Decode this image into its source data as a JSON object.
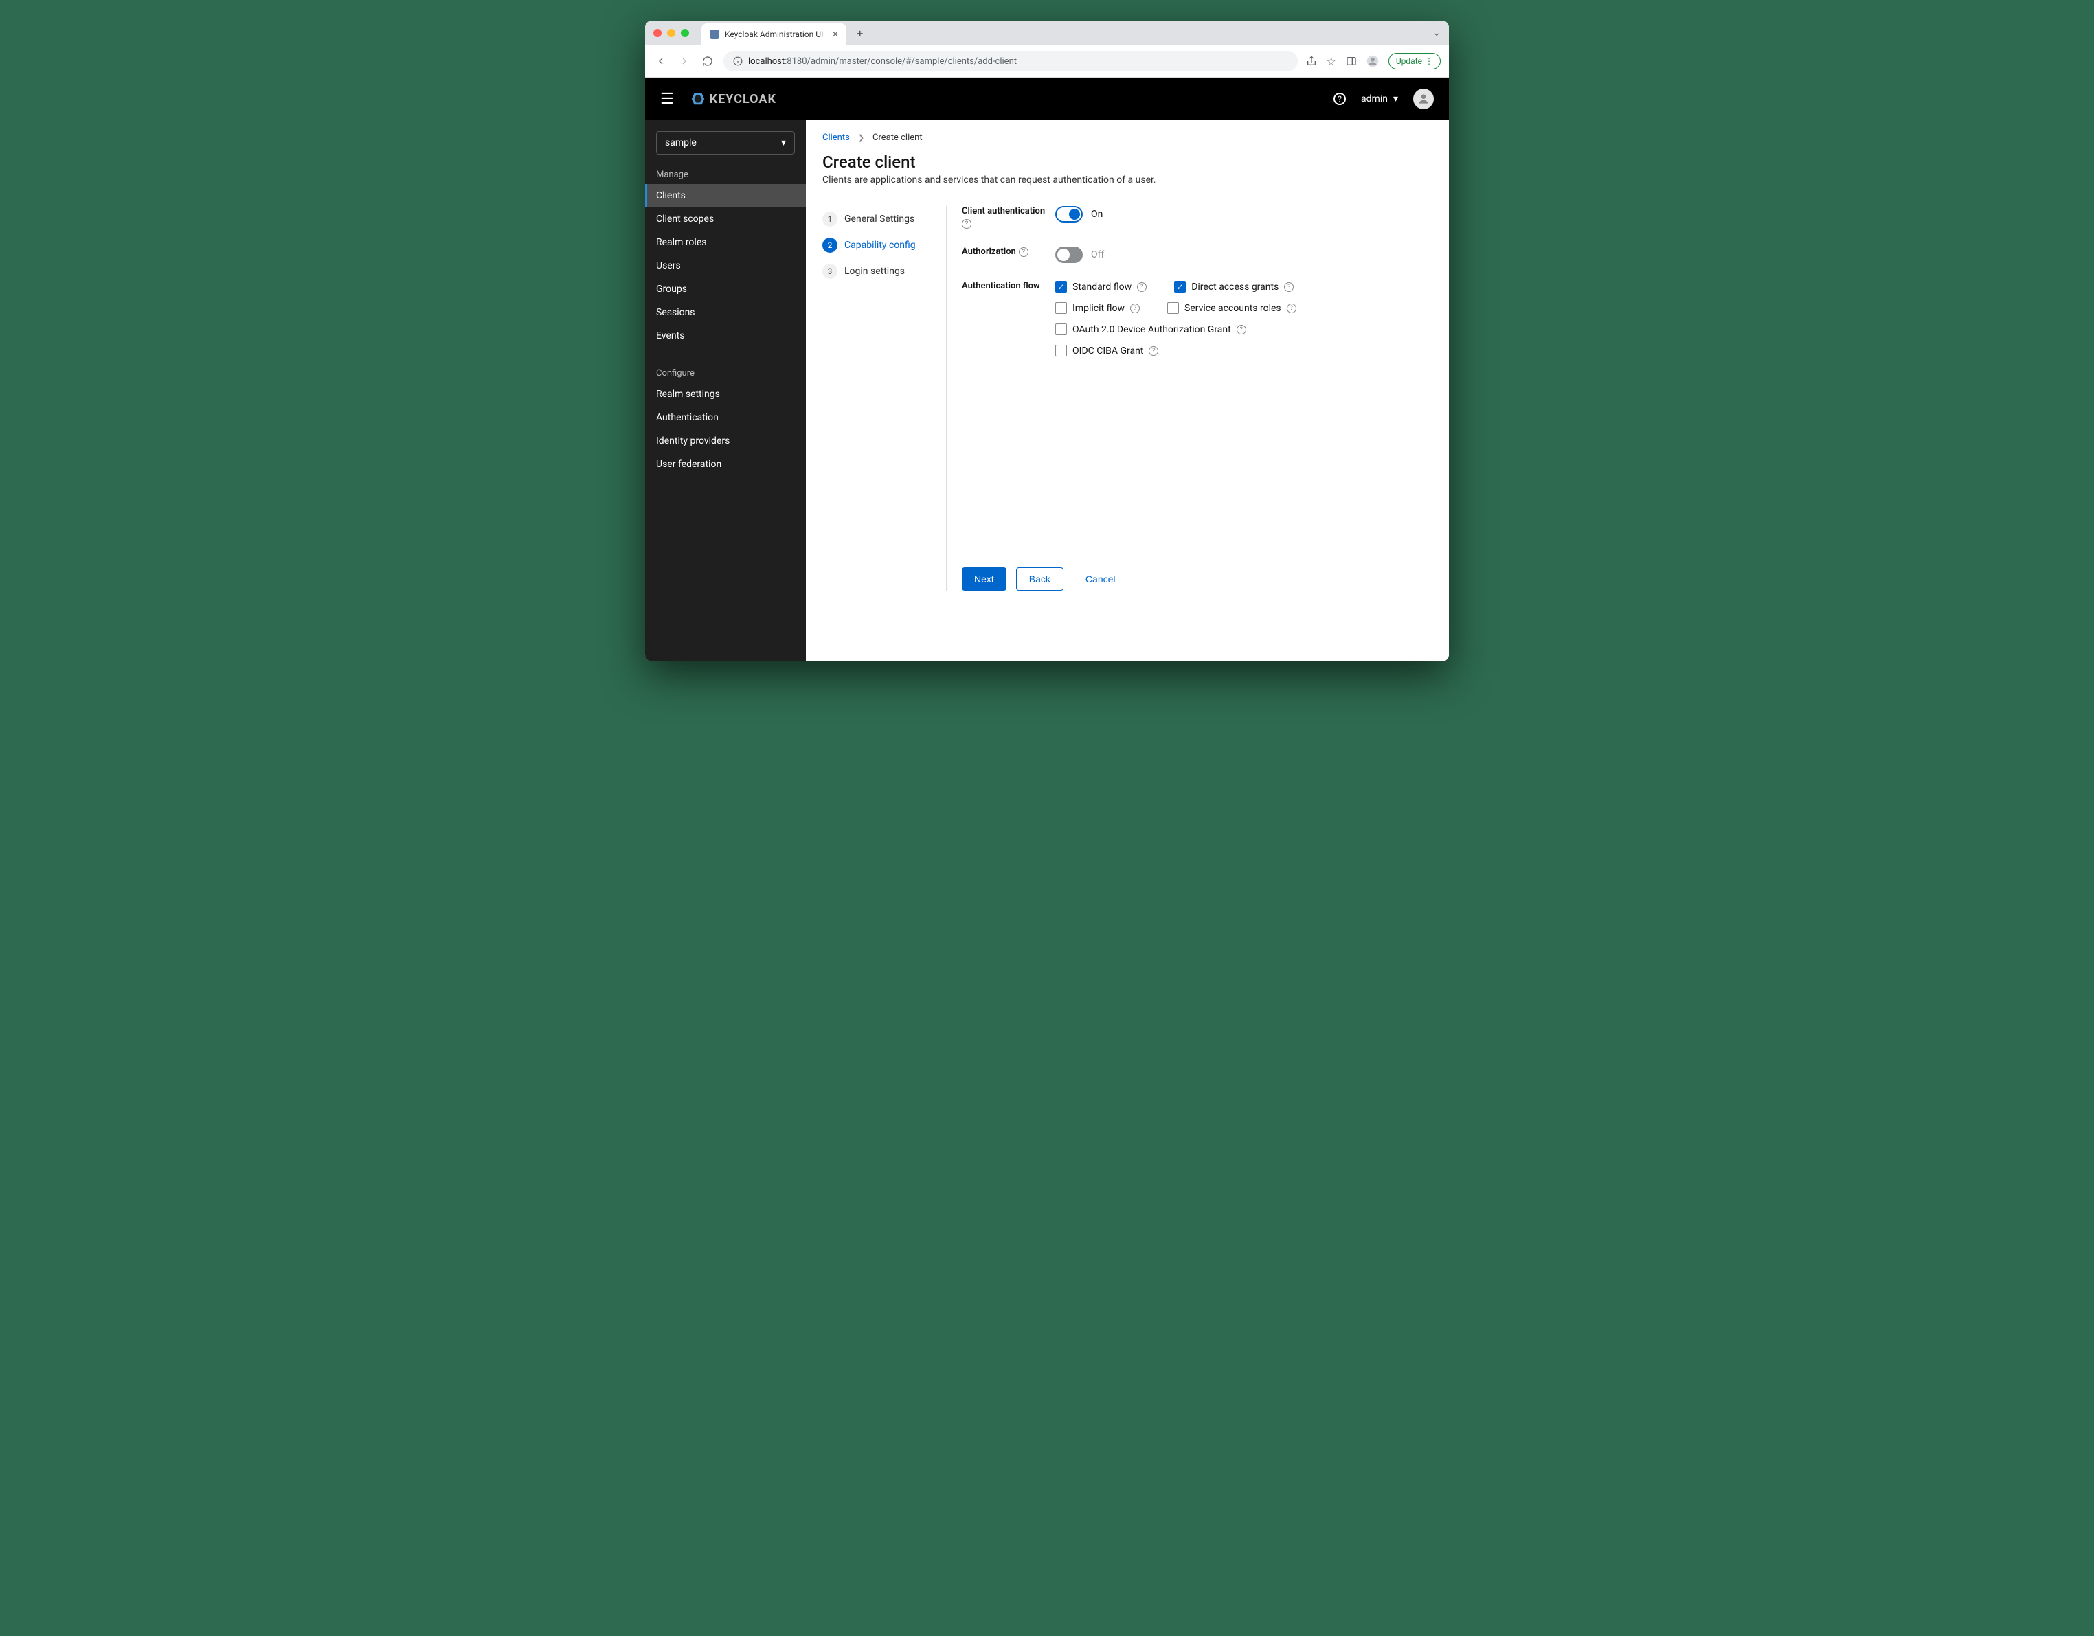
{
  "browser": {
    "tab_title": "Keycloak Administration UI",
    "url_host": "localhost",
    "url_port_path": ":8180/admin/master/console/#/sample/clients/add-client",
    "update_label": "Update"
  },
  "header": {
    "logo_text": "KEYCLOAK",
    "user": "admin"
  },
  "sidebar": {
    "realm": "sample",
    "group_manage": "Manage",
    "group_configure": "Configure",
    "manage_items": [
      "Clients",
      "Client scopes",
      "Realm roles",
      "Users",
      "Groups",
      "Sessions",
      "Events"
    ],
    "configure_items": [
      "Realm settings",
      "Authentication",
      "Identity providers",
      "User federation"
    ],
    "active": "Clients"
  },
  "breadcrumb": {
    "root": "Clients",
    "current": "Create client"
  },
  "page": {
    "title": "Create client",
    "desc": "Clients are applications and services that can request authentication of a user."
  },
  "wizard": {
    "steps": [
      "General Settings",
      "Capability config",
      "Login settings"
    ],
    "active_index": 1
  },
  "form": {
    "client_auth_label": "Client authentication",
    "client_auth_state": "On",
    "authorization_label": "Authorization",
    "authorization_state": "Off",
    "auth_flow_label": "Authentication flow",
    "flows": {
      "standard": {
        "label": "Standard flow",
        "checked": true
      },
      "direct": {
        "label": "Direct access grants",
        "checked": true
      },
      "implicit": {
        "label": "Implicit flow",
        "checked": false
      },
      "service": {
        "label": "Service accounts roles",
        "checked": false
      },
      "device": {
        "label": "OAuth 2.0 Device Authorization Grant",
        "checked": false
      },
      "ciba": {
        "label": "OIDC CIBA Grant",
        "checked": false
      }
    }
  },
  "buttons": {
    "next": "Next",
    "back": "Back",
    "cancel": "Cancel"
  }
}
